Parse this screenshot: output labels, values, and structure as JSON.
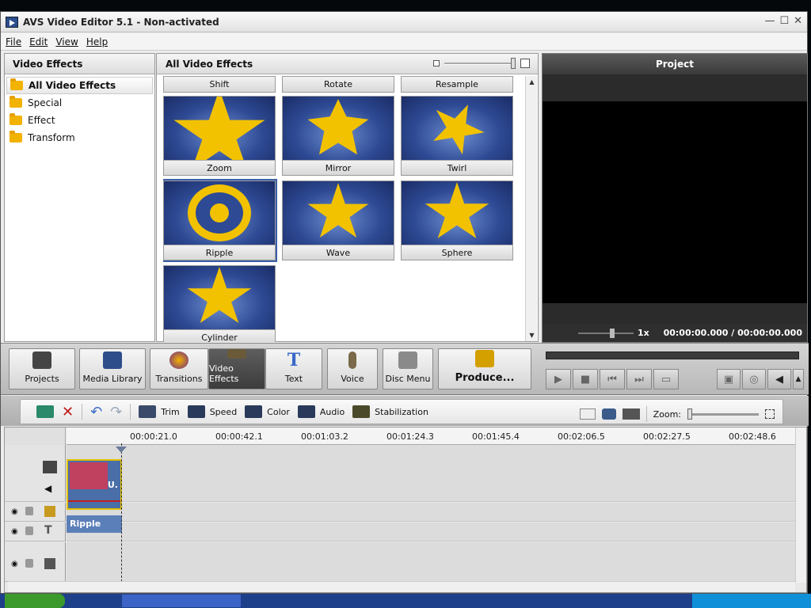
{
  "window": {
    "title": "AVS Video Editor 5.1 - Non-activated",
    "controls": [
      "—",
      "☐",
      "✕"
    ]
  },
  "menu": [
    "File",
    "Edit",
    "View",
    "Help"
  ],
  "left_pane": {
    "header": "Video Effects",
    "items": [
      {
        "label": "All Video Effects",
        "selected": true
      },
      {
        "label": "Special"
      },
      {
        "label": "Effect"
      },
      {
        "label": "Transform"
      }
    ]
  },
  "effects_pane": {
    "header": "All Video Effects",
    "top_row": [
      "Shift",
      "Rotate",
      "Resample"
    ],
    "tiles": [
      {
        "label": "Zoom"
      },
      {
        "label": "Mirror"
      },
      {
        "label": "Twirl"
      },
      {
        "label": "Ripple",
        "selected": true
      },
      {
        "label": "Wave"
      },
      {
        "label": "Sphere"
      },
      {
        "label": "Cylinder"
      }
    ]
  },
  "preview": {
    "header": "Project",
    "speed": "1x",
    "timecode": "00:00:00.000 / 00:00:00.000"
  },
  "toolbar": {
    "buttons": [
      "Projects",
      "Media Library",
      "Transitions",
      "Video Effects",
      "Text",
      "Voice",
      "Disc Menu"
    ],
    "active": "Video Effects",
    "produce": "Produce..."
  },
  "timeline_tools": {
    "buttons": [
      "Trim",
      "Speed",
      "Color",
      "Audio",
      "Stabilization"
    ],
    "zoom_label": "Zoom:"
  },
  "timeline": {
    "ticks": [
      "00:00:21.0",
      "00:00:42.1",
      "00:01:03.2",
      "00:01:24.3",
      "00:01:45.4",
      "00:02:06.5",
      "00:02:27.5",
      "00:02:48.6"
    ],
    "effect_clip": "Ripple",
    "video_clip_label": "U."
  },
  "colors": {
    "accent": "#3a5fa8",
    "star": "#f2c200",
    "tile_bg": "#2e4a94"
  }
}
